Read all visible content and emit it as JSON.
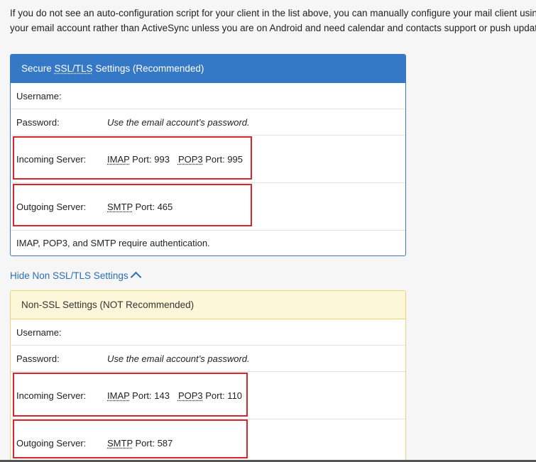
{
  "intro": {
    "line1": "If you do not see an auto-configuration script for your client in the list above, you can manually configure your mail client using t",
    "line2": "your email account rather than ActiveSync unless you are on Android and need calendar and contacts support or push updates."
  },
  "secure_panel": {
    "title_prefix": "Secure ",
    "title_abbr": "SSL/TLS",
    "title_suffix": " Settings (Recommended)",
    "username_label": "Username:",
    "username_value": "",
    "password_label": "Password:",
    "password_value": "Use the email account’s password.",
    "incoming_label": "Incoming Server:",
    "incoming_imap_abbr": "IMAP",
    "incoming_imap_port": " Port: 993",
    "incoming_pop3_abbr": "POP3",
    "incoming_pop3_port": " Port: 995",
    "outgoing_label": "Outgoing Server:",
    "outgoing_smtp_abbr": "SMTP",
    "outgoing_smtp_port": " Port: 465",
    "auth_note": "IMAP, POP3, and SMTP require authentication."
  },
  "toggle": {
    "label": "Hide Non SSL/TLS Settings"
  },
  "nonsecure_panel": {
    "title": "Non-SSL Settings (NOT Recommended)",
    "username_label": "Username:",
    "username_value": "",
    "password_label": "Password:",
    "password_value": "Use the email account’s password.",
    "incoming_label": "Incoming Server:",
    "incoming_imap_abbr": "IMAP",
    "incoming_imap_port": " Port: 143",
    "incoming_pop3_abbr": "POP3",
    "incoming_pop3_port": " Port: 110",
    "outgoing_label": "Outgoing Server:",
    "outgoing_smtp_abbr": "SMTP",
    "outgoing_smtp_port": " Port: 587"
  },
  "colors": {
    "secure_header_bg": "#3579c6",
    "nonsecure_header_bg": "#fcf7d8",
    "link": "#2a6db8",
    "highlight": "#d7262c"
  }
}
